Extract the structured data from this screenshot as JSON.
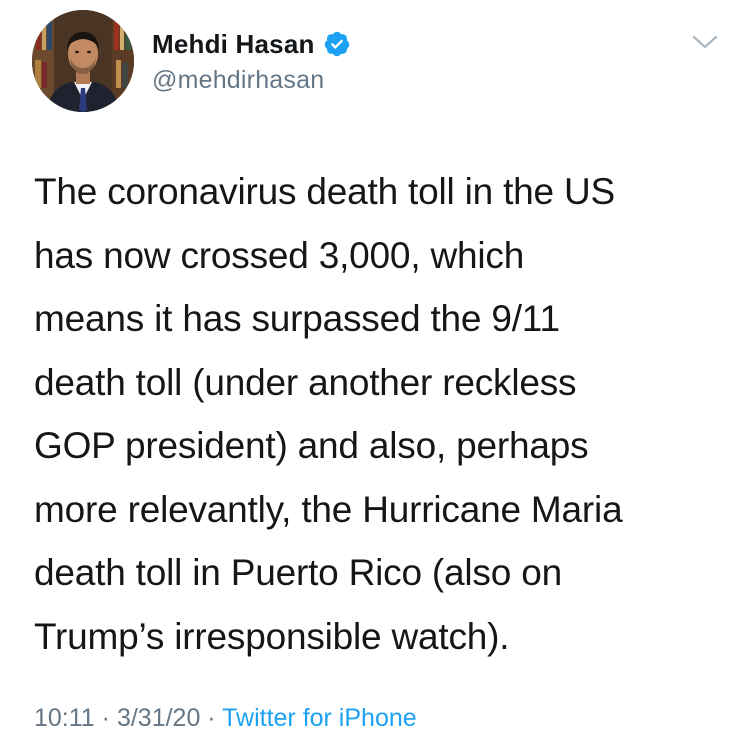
{
  "author": {
    "display_name": "Mehdi Hasan",
    "handle": "@mehdirhasan",
    "verified": true
  },
  "tweet": {
    "text": "The coronavirus death toll in the US\nhas now crossed 3,000, which\nmeans it has surpassed the 9/11\ndeath toll (under another reckless\nGOP president) and also, perhaps\nmore relevantly, the Hurricane Maria\ndeath toll in Puerto Rico (also on\nTrump’s irresponsible watch).",
    "time": "10:11",
    "date": "3/31/20",
    "separator": " · ",
    "source": "Twitter for iPhone"
  },
  "icons": {
    "verified": "verified-badge-icon",
    "caret": "chevron-down-icon"
  },
  "colors": {
    "text": "#14171a",
    "secondary": "#657786",
    "link": "#1da1f2",
    "verified": "#1da1f2",
    "background": "#ffffff"
  }
}
